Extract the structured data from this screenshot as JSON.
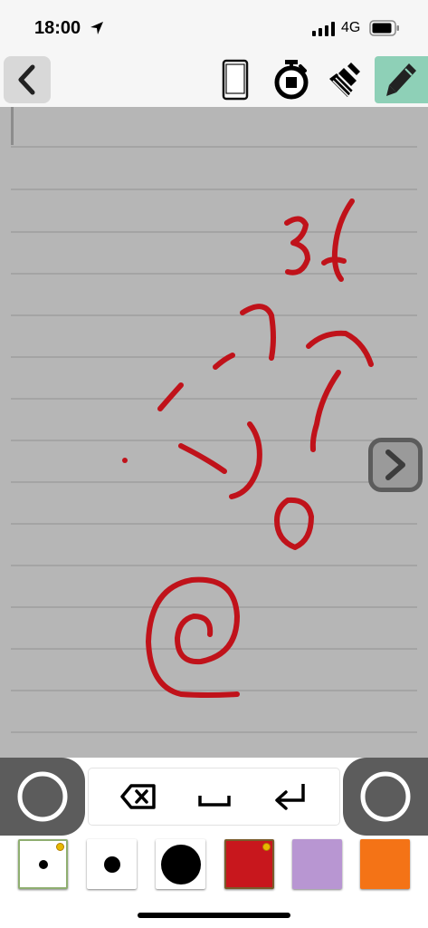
{
  "status_bar": {
    "time": "18:00",
    "network": "4G",
    "icons": [
      "location-arrow-icon",
      "signal-icon",
      "battery-icon"
    ]
  },
  "toolbar": {
    "icons": [
      "chevron-left-icon",
      "phone-icon",
      "stopwatch-icon",
      "broom-icon",
      "pencil-icon"
    ],
    "active_tool": "pen",
    "active_color": "#8ed0b7"
  },
  "canvas": {
    "background": "#b6b6b6",
    "line_color": "#9a9a9a",
    "ink_color": "#c0121a",
    "handwriting": "3f",
    "icons": [
      "chevron-right-icon"
    ]
  },
  "keybar": {
    "icons": [
      "ring-button-icon",
      "backspace-icon",
      "space-icon",
      "return-icon",
      "ring-button-icon"
    ]
  },
  "palette": {
    "swatches": [
      {
        "kind": "brush-small",
        "color": "#ffffff",
        "selected": true
      },
      {
        "kind": "brush-medium",
        "color": "#ffffff",
        "selected": false
      },
      {
        "kind": "brush-large",
        "color": "#ffffff",
        "selected": false
      },
      {
        "kind": "color",
        "color": "#c8171d",
        "selected": true
      },
      {
        "kind": "color",
        "color": "#b896d2",
        "selected": false
      },
      {
        "kind": "color",
        "color": "#f47316",
        "selected": false
      }
    ]
  }
}
